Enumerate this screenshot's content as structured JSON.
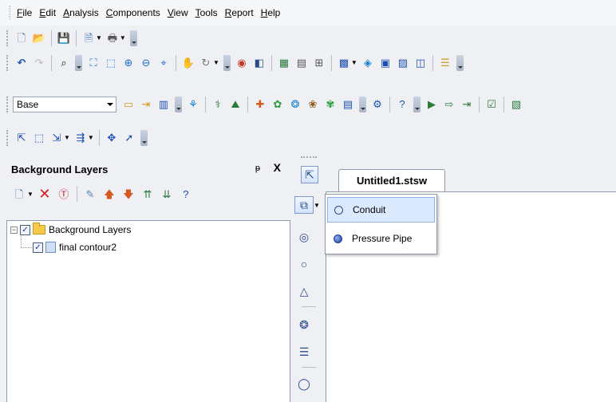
{
  "menubar": {
    "items": [
      "File",
      "Edit",
      "Analysis",
      "Components",
      "View",
      "Tools",
      "Report",
      "Help"
    ]
  },
  "toolbar": {
    "layer_combo_value": "Base"
  },
  "left_panel": {
    "title": "Background Layers",
    "pin_glyph": "ᵽ",
    "close_glyph": "X",
    "tree": {
      "root_label": "Background Layers",
      "root_checked": true,
      "child_label": "final contour2",
      "child_checked": true,
      "expander_glyph": "−",
      "check_glyph": "✓"
    }
  },
  "document": {
    "tab_label": "Untitled1.stsw"
  },
  "popup_menu": {
    "items": [
      {
        "label": "Conduit",
        "icon": "conduit-icon"
      },
      {
        "label": "Pressure Pipe",
        "icon": "pressure-pipe-icon"
      }
    ]
  },
  "colors": {
    "accent": "#dceaff",
    "window_bg": "#eef0f4"
  }
}
